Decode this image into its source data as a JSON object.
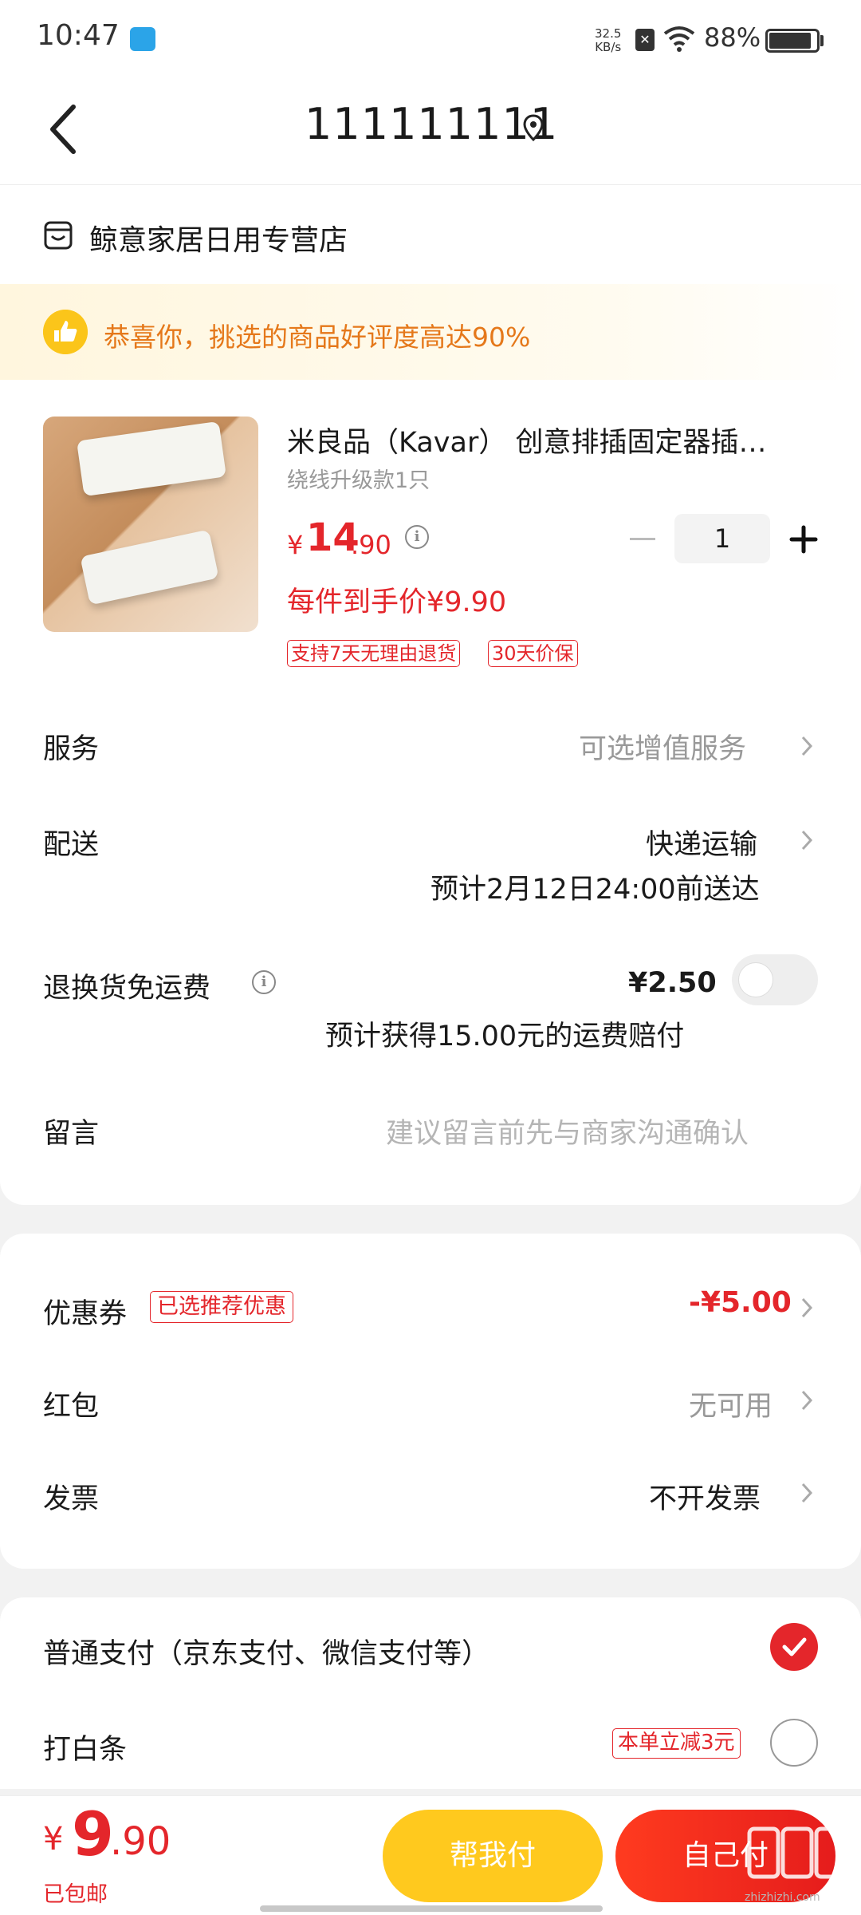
{
  "status_bar": {
    "time": "10:47",
    "net_speed_value": "32.5",
    "net_speed_unit": "KB/s",
    "battery": "88%",
    "icons": [
      "app-notification-icon",
      "sim-off-icon",
      "wifi-icon",
      "battery-icon"
    ]
  },
  "header": {
    "title": "111111111",
    "icons": [
      "back-arrow-icon",
      "location-pin-icon"
    ]
  },
  "store": {
    "name": "鲸意家居日用专营店",
    "icon": "store-icon"
  },
  "praise": {
    "text": "恭喜你，挑选的商品好评度高达90%",
    "icon": "thumbs-up-icon"
  },
  "product": {
    "title": "米良品（Kavar） 创意排插固定器插…",
    "variant": "绕线升级款1只",
    "price_symbol": "¥",
    "price_int": "14",
    "price_dec": ".90",
    "quantity": "1",
    "each_price": "每件到手价¥9.90",
    "tags": [
      "支持7天无理由退货",
      "30天价保"
    ]
  },
  "rows": {
    "service_label": "服务",
    "service_value": "可选增值服务",
    "delivery_label": "配送",
    "delivery_value": "快递运输",
    "delivery_eta": "预计2月12日24:00前送达",
    "return_label": "退换货免运费",
    "return_value": "¥2.50",
    "return_note": "预计获得15.00元的运费赔付",
    "message_label": "留言",
    "message_placeholder": "建议留言前先与商家沟通确认"
  },
  "discounts": {
    "coupon_label": "优惠券",
    "coupon_tag": "已选推荐优惠",
    "coupon_value": "-¥5.00",
    "redpacket_label": "红包",
    "redpacket_value": "无可用",
    "invoice_label": "发票",
    "invoice_value": "不开发票"
  },
  "payment": {
    "normal_label": "普通支付（京东支付、微信支付等）",
    "normal_selected": true,
    "baitiao_label": "打白条",
    "baitiao_tag": "本单立减3元",
    "baitiao_selected": false
  },
  "bottom": {
    "total_symbol": "¥",
    "total_int": "9",
    "total_dec": ".90",
    "free_shipping": "已包邮",
    "help_pay": "帮我付",
    "self_pay": "自己付",
    "watermark": "zhizhizhi.com"
  },
  "colors": {
    "accent_red": "#e4262b",
    "help_yellow": "#ffc91e",
    "praise_orange": "#e5781a"
  }
}
